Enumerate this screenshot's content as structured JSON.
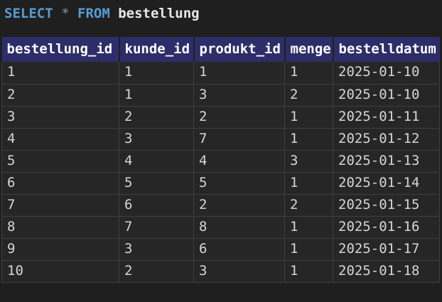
{
  "query": {
    "tokens": [
      {
        "text": "SELECT",
        "type": "keyword"
      },
      {
        "text": "*",
        "type": "operator"
      },
      {
        "text": "FROM",
        "type": "keyword"
      },
      {
        "text": "bestellung",
        "type": "identifier"
      }
    ]
  },
  "table": {
    "columns": [
      "bestellung_id",
      "kunde_id",
      "produkt_id",
      "menge",
      "bestelldatum"
    ],
    "rows": [
      [
        "1",
        "1",
        "1",
        "1",
        "2025-01-10"
      ],
      [
        "2",
        "1",
        "3",
        "2",
        "2025-01-10"
      ],
      [
        "3",
        "2",
        "2",
        "1",
        "2025-01-11"
      ],
      [
        "4",
        "3",
        "7",
        "1",
        "2025-01-12"
      ],
      [
        "5",
        "4",
        "4",
        "3",
        "2025-01-13"
      ],
      [
        "6",
        "5",
        "5",
        "1",
        "2025-01-14"
      ],
      [
        "7",
        "6",
        "2",
        "2",
        "2025-01-15"
      ],
      [
        "8",
        "7",
        "8",
        "1",
        "2025-01-16"
      ],
      [
        "9",
        "3",
        "6",
        "1",
        "2025-01-17"
      ],
      [
        "10",
        "2",
        "3",
        "1",
        "2025-01-18"
      ]
    ]
  },
  "colors": {
    "page_bg": "#1f1f1f",
    "cell_bg": "#262626",
    "border": "#3f3f3f",
    "header_bg": "#2d2d69",
    "header_text": "#ffffff",
    "cell_text": "#d6d6d6",
    "keyword": "#569cd6",
    "operator": "#8b95a1",
    "identifier": "#e8e8e8"
  }
}
